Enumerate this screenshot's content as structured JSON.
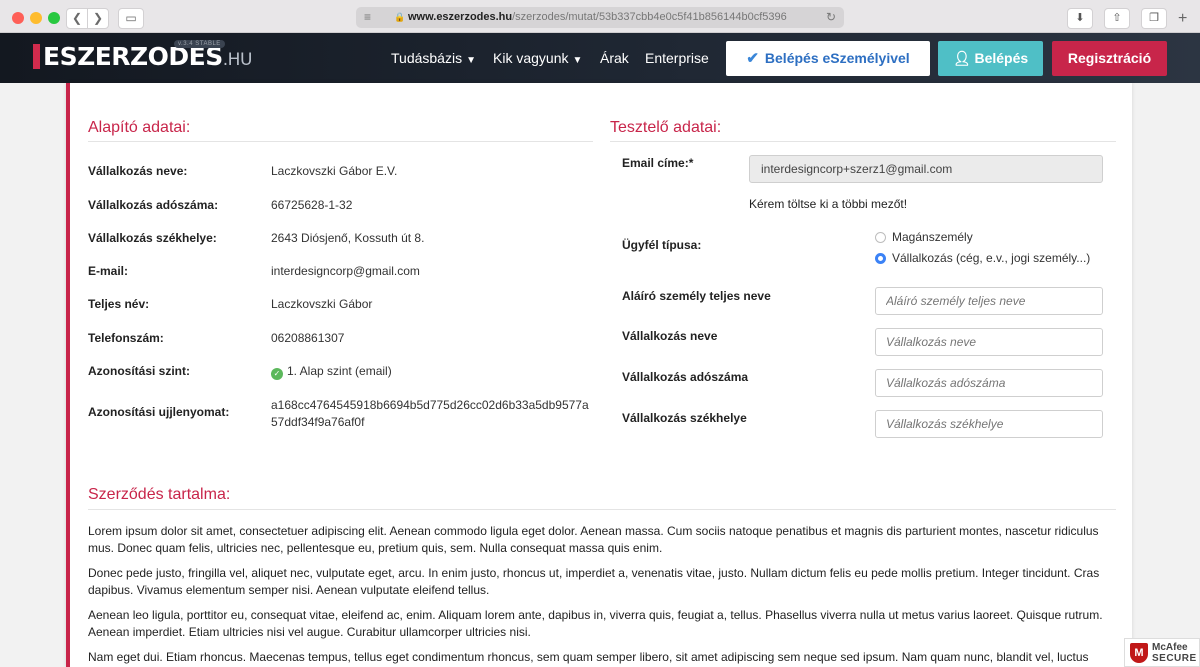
{
  "browser": {
    "url_host": "www.eszerzodes.hu",
    "url_path": "/szerzodes/mutat/53b337cbb4e0c5f41b856144b0cf5396",
    "icons": [
      "back-icon",
      "forward-icon",
      "sidebar-icon",
      "lock-icon",
      "reload-icon",
      "download-icon",
      "share-icon",
      "tabs-icon",
      "new-tab-icon"
    ]
  },
  "header": {
    "logo": "ESZERZODES",
    "logo_suffix": ".HU",
    "version": "v.3.4 STABLE",
    "nav": [
      {
        "label": "Tudásbázis",
        "dropdown": true
      },
      {
        "label": "Kik vagyunk",
        "dropdown": true
      },
      {
        "label": "Árak"
      },
      {
        "label": "Enterprise"
      }
    ],
    "btn_eszemely": "Belépés eSzemélyivel",
    "btn_login": "Belépés",
    "btn_register": "Regisztráció",
    "colors": {
      "accent": "#c8254a",
      "teal": "#4fbfc6",
      "blue": "#2d6fc2"
    }
  },
  "founder": {
    "title": "Alapító adatai:",
    "rows": [
      {
        "label": "Vállalkozás neve:",
        "value": "Laczkovszki Gábor E.V."
      },
      {
        "label": "Vállalkozás adószáma:",
        "value": "66725628-1-32"
      },
      {
        "label": "Vállalkozás székhelye:",
        "value": "2643 Diósjenő, Kossuth út 8."
      },
      {
        "label": "E-mail:",
        "value": "interdesigncorp@gmail.com"
      },
      {
        "label": "Teljes név:",
        "value": "Laczkovszki Gábor"
      },
      {
        "label": "Telefonszám:",
        "value": "06208861307"
      },
      {
        "label": "Azonosítási szint:",
        "value": "1. Alap szint (email)"
      }
    ],
    "fingerprint_label": "Azonosítási ujjlenyomat:",
    "fingerprint_line1": "a168cc4764545918b6694b5d775d26cc02d6b33a5db9577a",
    "fingerprint_line2": "57ddf34f9a76af0f"
  },
  "tester": {
    "title": "Tesztelő adatai:",
    "email_label": "Email címe:*",
    "email_value": "interdesigncorp+szerz1@gmail.com",
    "hint": "Kérem töltse ki a többi mezőt!",
    "client_type_label": "Ügyfél típusa:",
    "options": [
      "Magánszemély",
      "Vállalkozás (cég, e.v., jogi személy...)"
    ],
    "selected_option": "Vállalkozás (cég, e.v., jogi személy...)",
    "fields": [
      {
        "label": "Aláíró személy teljes neve",
        "placeholder": "Aláíró személy teljes neve"
      },
      {
        "label": "Vállalkozás neve",
        "placeholder": "Vállalkozás neve"
      },
      {
        "label": "Vállalkozás adószáma",
        "placeholder": "Vállalkozás adószáma"
      },
      {
        "label": "Vállalkozás székhelye",
        "placeholder": "Vállalkozás székhelye"
      }
    ]
  },
  "contract": {
    "title": "Szerződés tartalma:",
    "paragraphs": [
      "Lorem ipsum dolor sit amet, consectetuer adipiscing elit. Aenean commodo ligula eget dolor. Aenean massa. Cum sociis natoque penatibus et magnis dis parturient montes, nascetur ridiculus mus. Donec quam felis, ultricies nec, pellentesque eu, pretium quis, sem. Nulla consequat massa quis enim.",
      "Donec pede justo, fringilla vel, aliquet nec, vulputate eget, arcu. In enim justo, rhoncus ut, imperdiet a, venenatis vitae, justo. Nullam dictum felis eu pede mollis pretium. Integer tincidunt. Cras dapibus. Vivamus elementum semper nisi. Aenean vulputate eleifend tellus.",
      "Aenean leo ligula, porttitor eu, consequat vitae, eleifend ac, enim. Aliquam lorem ante, dapibus in, viverra quis, feugiat a, tellus. Phasellus viverra nulla ut metus varius laoreet. Quisque rutrum. Aenean imperdiet. Etiam ultricies nisi vel augue. Curabitur ullamcorper ultricies nisi.",
      "Nam eget dui. Etiam rhoncus. Maecenas tempus, tellus eget condimentum rhoncus, sem quam semper libero, sit amet adipiscing sem neque sed ipsum. Nam quam nunc, blandit vel, luctus"
    ]
  },
  "badge": {
    "line1": "McAfee",
    "line2": "SECURE"
  }
}
